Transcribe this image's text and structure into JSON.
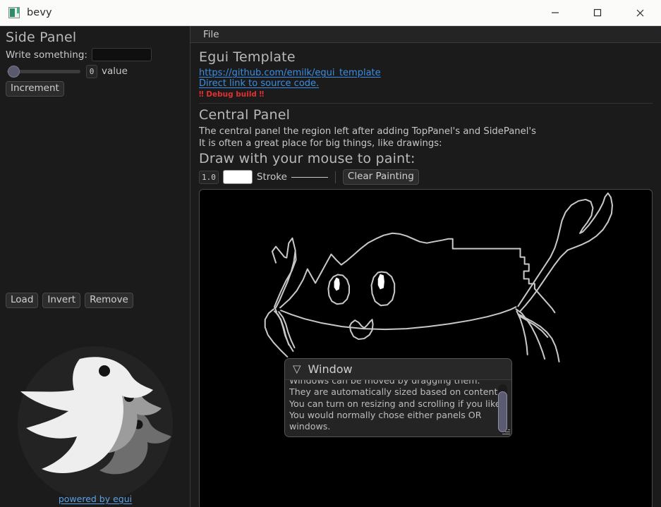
{
  "window": {
    "title": "bevy",
    "icon": "bevy-app-icon",
    "controls": {
      "minimize": "minimize-icon",
      "maximize": "maximize-icon",
      "close": "close-icon"
    }
  },
  "side_panel": {
    "heading": "Side Panel",
    "write_label": "Write something:",
    "write_value": "",
    "write_placeholder": "",
    "slider_value": 0,
    "slider_min": 0,
    "slider_max": 100,
    "drag_value": "0",
    "value_label": "value",
    "increment_label": "Increment",
    "buttons": [
      {
        "label": "Load",
        "name": "load-button"
      },
      {
        "label": "Invert",
        "name": "invert-button"
      },
      {
        "label": "Remove",
        "name": "remove-button"
      }
    ],
    "logo_alt": "bevy-birds-logo",
    "powered_by": "powered by egui"
  },
  "top_panel": {
    "menu": [
      {
        "label": "File",
        "name": "menu-file"
      }
    ]
  },
  "central_panel": {
    "app_title": "Egui Template",
    "repo_link": "https://github.com/emilk/egui_template",
    "source_link": "Direct link to source code.",
    "debug_badge": "‼ Debug build ‼",
    "heading": "Central Panel",
    "paragraph_1": "The central panel the region left after adding TopPanel's and SidePanel's",
    "paragraph_2": "It is often a great place for big things, like drawings:",
    "paint_heading": "Draw with your mouse to paint:",
    "stroke_width": "1.0",
    "stroke_color": "#ffffff",
    "stroke_label": "Stroke",
    "clear_label": "Clear Painting",
    "painting": {
      "background": "#000000",
      "line_color": "#c8c8c8",
      "subject": "hand-drawn-crab"
    }
  },
  "floating_window": {
    "collapse_icon": "▽",
    "title": "Window",
    "lines": [
      "Windows can be moved by dragging them.",
      "They are automatically sized based on contents.",
      "You can turn on resizing and scrolling if you like.",
      "You would normally chose either panels OR",
      "windows."
    ],
    "scrollbar": "vertical-scrollbar",
    "resize_grip": "resize-grip"
  },
  "colors": {
    "app_bg": "#1b1b1b",
    "panel_bg": "#242424",
    "titlebar_bg": "#fbfbfa",
    "link": "#3a8ee6",
    "debug_red": "#e03030",
    "text": "#c6c6c6",
    "accent": "#5b5b72"
  }
}
